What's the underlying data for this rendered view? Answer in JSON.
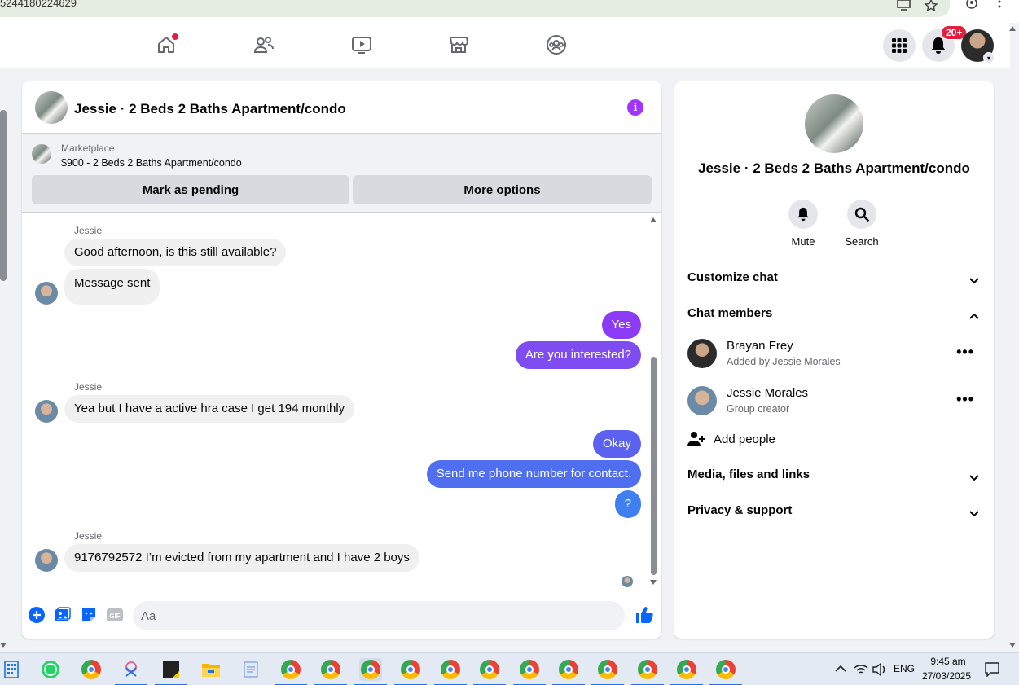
{
  "browser": {
    "url_fragment": "5244180224629"
  },
  "nav": {
    "notifications_badge": "20+"
  },
  "chat": {
    "title": "Jessie · 2 Beds 2 Baths Apartment/condo",
    "listing": {
      "source": "Marketplace",
      "description": "$900 - 2 Beds 2 Baths Apartment/condo",
      "mark_pending_label": "Mark as pending",
      "more_options_label": "More options"
    },
    "messages": [
      {
        "sender": "Jessie",
        "text": "Good afternoon, is this still available?"
      },
      {
        "text": "Message sent"
      },
      {
        "text": "Yes"
      },
      {
        "text": "Are you interested?"
      },
      {
        "sender": "Jessie",
        "text": "Yea but I have a active hra case I get 194 monthly"
      },
      {
        "text": "Okay"
      },
      {
        "text": "Send me phone number for contact."
      },
      {
        "text": "?"
      },
      {
        "sender": "Jessie",
        "text": "9176792572 I’m evicted from my apartment and I have 2 boys"
      }
    ],
    "composer": {
      "placeholder": "Aa"
    }
  },
  "info": {
    "title": "Jessie · 2 Beds 2 Baths Apartment/condo",
    "actions": [
      {
        "label": "Mute",
        "icon": "bell-icon"
      },
      {
        "label": "Search",
        "icon": "search-icon"
      }
    ],
    "sections": {
      "customize": "Customize chat",
      "members": "Chat members",
      "media": "Media, files and links",
      "privacy": "Privacy & support"
    },
    "members": [
      {
        "name": "Brayan Frey",
        "subtitle": "Added by Jessie Morales"
      },
      {
        "name": "Jessie Morales",
        "subtitle": "Group creator"
      }
    ],
    "add_people": "Add people"
  },
  "taskbar": {
    "language": "ENG",
    "time": "9:45 am",
    "date": "27/03/2025"
  },
  "colors": {
    "messenger_purple": "#a033ff",
    "bubble_violet": "#8b3bf5",
    "bubble_blue": "#4f6ef0",
    "fb_blue": "#0866ff",
    "notification_red": "#e41e3f"
  }
}
